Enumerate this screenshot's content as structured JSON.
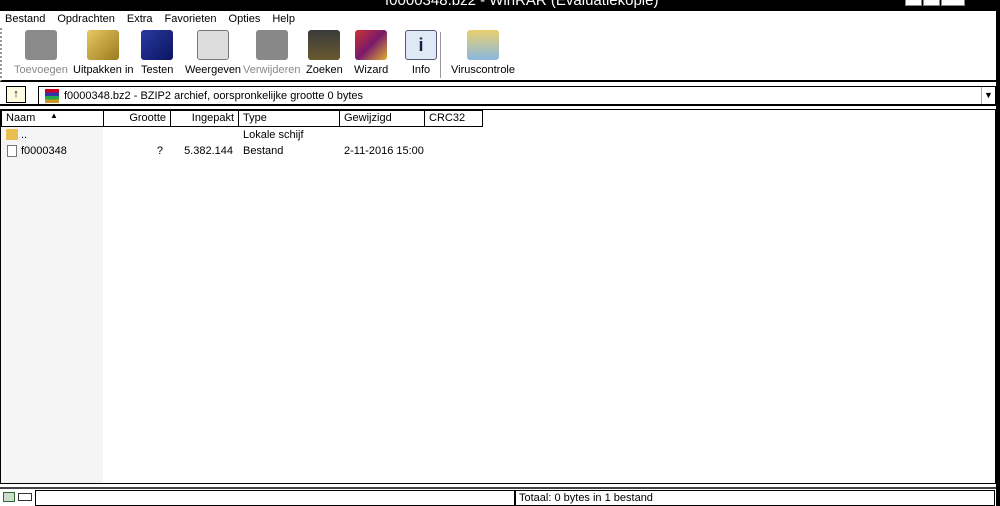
{
  "window": {
    "title": "f0000348.bz2 - WinRAR (Evaluatiekopie)"
  },
  "menu": [
    "Bestand",
    "Opdrachten",
    "Extra",
    "Favorieten",
    "Opties",
    "Help"
  ],
  "toolbar": [
    {
      "label": "Toevoegen",
      "icon": "add-archive-icon",
      "enabled": false
    },
    {
      "label": "Uitpakken in",
      "icon": "extract-icon",
      "enabled": true
    },
    {
      "label": "Testen",
      "icon": "test-icon",
      "enabled": true
    },
    {
      "label": "Weergeven",
      "icon": "view-icon",
      "enabled": true
    },
    {
      "label": "Verwijderen",
      "icon": "delete-icon",
      "enabled": false
    },
    {
      "label": "Zoeken",
      "icon": "find-icon",
      "enabled": true
    },
    {
      "label": "Wizard",
      "icon": "wizard-icon",
      "enabled": true
    },
    {
      "label": "Info",
      "icon": "info-icon",
      "enabled": true
    },
    {
      "label": "Viruscontrole",
      "icon": "virus-scan-icon",
      "enabled": true
    }
  ],
  "address": {
    "text": "f0000348.bz2 - BZIP2 archief, oorspronkelijke grootte 0 bytes"
  },
  "columns": [
    "Naam",
    "Grootte",
    "Ingepakt",
    "Type",
    "Gewijzigd",
    "CRC32"
  ],
  "rows": [
    {
      "name": "..",
      "size": "",
      "packed": "",
      "type": "Lokale schijf",
      "modified": "",
      "crc": ""
    },
    {
      "name": "f0000348",
      "size": "?",
      "packed": "5.382.144",
      "type": "Bestand",
      "modified": "2-11-2016 15:00",
      "crc": ""
    }
  ],
  "status": {
    "total": "Totaal: 0 bytes in 1 bestand"
  }
}
